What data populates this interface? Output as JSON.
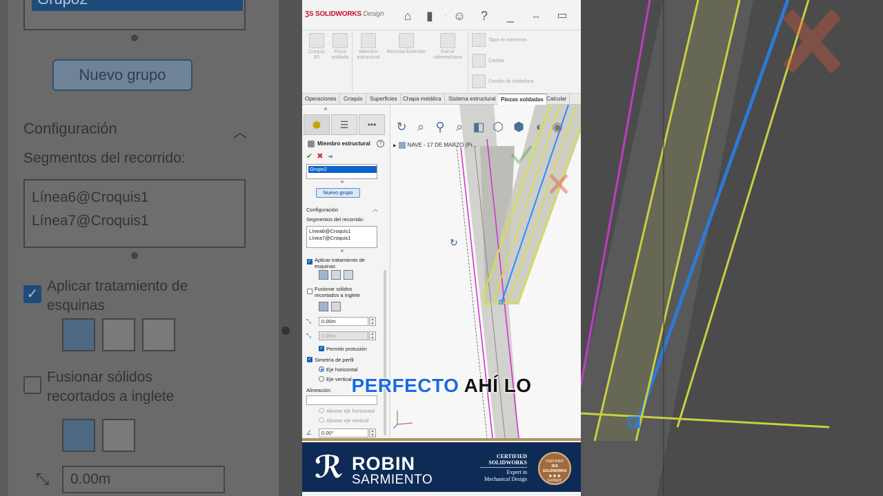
{
  "app": {
    "brand_name": "SOLIDWORKS",
    "brand_suffix": "Design"
  },
  "ribbon": {
    "items": [
      {
        "label": "Croquis 3D"
      },
      {
        "label": "Pieza soldada"
      },
      {
        "label": "Miembro estructural"
      },
      {
        "label": "Recortar/Extender"
      },
      {
        "label": "Extruir saliente/base"
      }
    ],
    "right_items": [
      {
        "label": "Tapa en extremos"
      },
      {
        "label": "Cartela"
      },
      {
        "label": "Cordón de soldadura"
      }
    ]
  },
  "tabs": [
    {
      "label": "Operaciones"
    },
    {
      "label": "Croquis"
    },
    {
      "label": "Superficies"
    },
    {
      "label": "Chapa metálica"
    },
    {
      "label": "Sistema estructural"
    },
    {
      "label": "Piezas soldadas"
    },
    {
      "label": "Calcular"
    }
  ],
  "property_manager": {
    "title": "Miembro estructural",
    "group_list_selected": "Grupo2",
    "new_group_button": "Nuevo grupo",
    "configuration_header": "Configuración",
    "path_segments_label": "Segmentos del recorrido:",
    "path_segments": [
      "Línea6@Croquis1",
      "Línea7@Croquis1"
    ],
    "apply_corner_label": "Aplicar tratamiento de esquinas",
    "apply_corner_checked": true,
    "merge_miter_label": "Fusionar sólidos recortados a inglete",
    "merge_miter_checked": false,
    "gap1_value": "0.00m",
    "gap2_value": "0.00m",
    "allow_protrusion_label": "Permitir protusión",
    "allow_protrusion_checked": true,
    "profile_symmetry_label": "Simetría de perfil",
    "profile_symmetry_checked": true,
    "axis_horizontal_label": "Eje horizontal",
    "axis_vertical_label": "Eje vertical",
    "alignment_label": "Alineación:",
    "align_horizontal_label": "Alinear eje horizontal",
    "align_vertical_label": "Alinear eje vertical",
    "angle_value": "0.00°"
  },
  "viewport": {
    "tree_root": "NAVE - 17 DE MARZO (Pr..."
  },
  "caption": {
    "highlight": "PERFECTO",
    "rest": "AHÍ LO"
  },
  "banner": {
    "name_first": "ROBIN",
    "name_last": "SARMIENTO",
    "cert_line1": "CERTIFIED",
    "cert_line2": "SOLIDWORKS",
    "cert_line3": "Expert in",
    "cert_line4": "Mechanical Design",
    "badge_top": "CERTIFIED",
    "badge_mid": "3DS SOLIDWORKS",
    "badge_bottom": "EXPERT"
  },
  "zoom_left": {
    "group_selected": "Grupo2",
    "new_group_button": "Nuevo grupo",
    "configuration_header": "Configuración",
    "path_segments_label": "Segmentos del recorrido:",
    "path_segments": [
      "Línea6@Croquis1",
      "Línea7@Croquis1"
    ],
    "apply_corner_label": "Aplicar tratamiento de esquinas",
    "merge_miter_label": "Fusionar sólidos recortados a inglete",
    "gap1_value": "0.00m"
  },
  "colors": {
    "banner_navy": "#0d2b55",
    "banner_gold": "#b5965a",
    "caption_blue": "#1a6be0",
    "selection_blue": "#0b64c8",
    "sketch_magenta": "#d02cd0",
    "profile_yellow": "#d8e03a",
    "axis_blue": "#2a8cff"
  }
}
